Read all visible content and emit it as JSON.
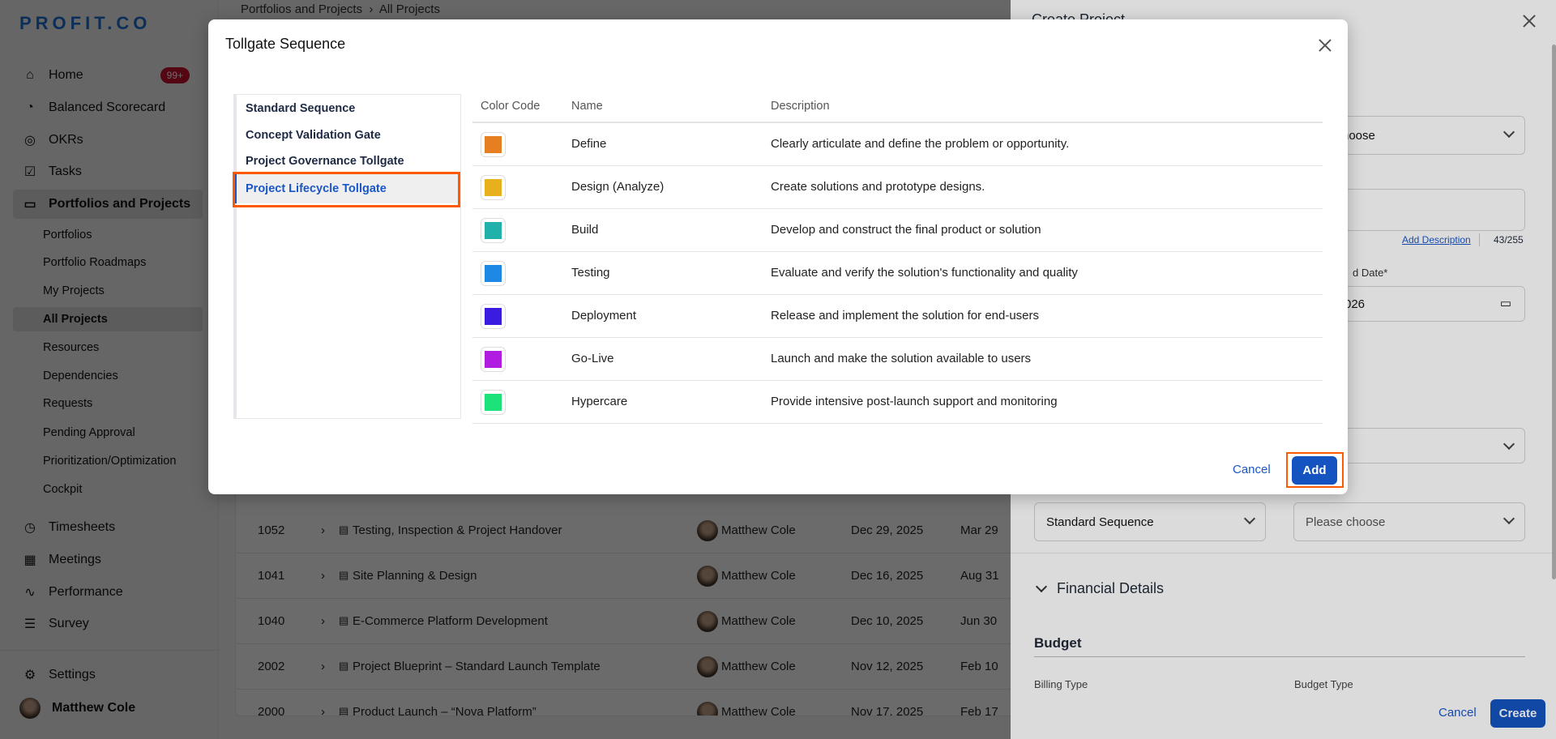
{
  "app": {
    "logo": "PROFIT.CO"
  },
  "sidebar": {
    "items": [
      {
        "label": "Home",
        "icon": "home-icon",
        "badge": "99+"
      },
      {
        "label": "Balanced Scorecard",
        "icon": "gauge-icon"
      },
      {
        "label": "OKRs",
        "icon": "target-icon"
      },
      {
        "label": "Tasks",
        "icon": "clipboard-check-icon"
      },
      {
        "label": "Portfolios and Projects",
        "icon": "briefcase-icon"
      }
    ],
    "sub_items": [
      "Portfolios",
      "Portfolio Roadmaps",
      "My Projects",
      "All Projects",
      "Resources",
      "Dependencies",
      "Requests",
      "Pending Approval",
      "Prioritization/Optimization",
      "Cockpit"
    ],
    "items2": [
      {
        "label": "Timesheets",
        "icon": "stopwatch-icon"
      },
      {
        "label": "Meetings",
        "icon": "calendar-icon"
      },
      {
        "label": "Performance",
        "icon": "chart-line-icon"
      },
      {
        "label": "Survey",
        "icon": "survey-icon"
      }
    ],
    "settings": "Settings",
    "user": "Matthew Cole"
  },
  "main": {
    "breadcrumb": [
      "Portfolios and Projects",
      "All Projects"
    ],
    "rows": [
      {
        "id": "1052",
        "name": "Testing, Inspection & Project Handover",
        "owner": "Matthew Cole",
        "start": "Dec 29, 2025",
        "end": "Mar 29"
      },
      {
        "id": "1041",
        "name": "Site Planning & Design",
        "owner": "Matthew Cole",
        "start": "Dec 16, 2025",
        "end": "Aug 31"
      },
      {
        "id": "1040",
        "name": "E-Commerce Platform Development",
        "owner": "Matthew Cole",
        "start": "Dec 10, 2025",
        "end": "Jun 30"
      },
      {
        "id": "2002",
        "name": "Project Blueprint – Standard Launch Template",
        "owner": "Matthew Cole",
        "start": "Nov 12, 2025",
        "end": "Feb 10"
      },
      {
        "id": "2000",
        "name": "Product Launch – “Nova Platform”",
        "owner": "Matthew Cole",
        "start": "Nov 17, 2025",
        "end": "Feb 17"
      }
    ]
  },
  "panel": {
    "title": "Create Project",
    "choose1": "hoose",
    "add_description": "Add Description",
    "char_count": "43/255",
    "end_date_label": "d Date*",
    "end_date_value": "026",
    "sequence": "Standard Sequence",
    "choose2": "Please choose",
    "financial": "Financial Details",
    "budget": "Budget",
    "billing_type": "Billing Type",
    "budget_type": "Budget Type",
    "cancel": "Cancel",
    "create": "Create"
  },
  "modal": {
    "title": "Tollgate Sequence",
    "sequences": [
      "Standard Sequence",
      "Concept Validation Gate",
      "Project Governance Tollgate",
      "Project Lifecycle Tollgate"
    ],
    "selected_index": 3,
    "columns": [
      "Color Code",
      "Name",
      "Description"
    ],
    "stages": [
      {
        "color": "#E67E22",
        "name": "Define",
        "description": "Clearly articulate and define the problem or opportunity."
      },
      {
        "color": "#E6B11C",
        "name": "Design (Analyze)",
        "description": "Create solutions and prototype designs."
      },
      {
        "color": "#20B2AA",
        "name": "Build",
        "description": "Develop and construct the final product or solution"
      },
      {
        "color": "#1E88E5",
        "name": "Testing",
        "description": "Evaluate and verify the solution's functionality and quality"
      },
      {
        "color": "#3A1CE0",
        "name": "Deployment",
        "description": "Release and implement the solution for end-users"
      },
      {
        "color": "#B01CE0",
        "name": "Go-Live",
        "description": "Launch and make the solution available to users"
      },
      {
        "color": "#1DE27A",
        "name": "Hypercare",
        "description": "Provide intensive post-launch support and monitoring"
      }
    ],
    "cancel": "Cancel",
    "add": "Add"
  },
  "colors": {
    "accent": "#1554c0",
    "highlight": "#ff5a00"
  }
}
